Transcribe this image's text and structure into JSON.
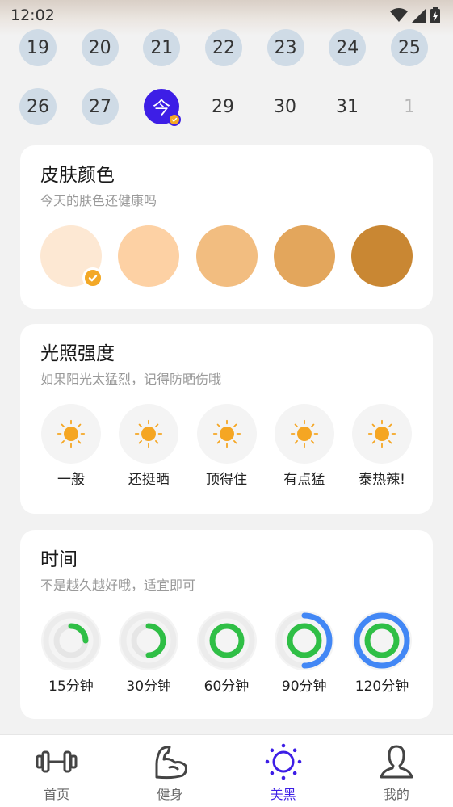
{
  "status_bar": {
    "time": "12:02",
    "icons": [
      "wifi-icon",
      "signal-icon",
      "battery-charging-icon"
    ]
  },
  "calendar": {
    "row1": [
      {
        "label": "19",
        "state": "done"
      },
      {
        "label": "20",
        "state": "done"
      },
      {
        "label": "21",
        "state": "done"
      },
      {
        "label": "22",
        "state": "done"
      },
      {
        "label": "23",
        "state": "done"
      },
      {
        "label": "24",
        "state": "done"
      },
      {
        "label": "25",
        "state": "done"
      }
    ],
    "row2": [
      {
        "label": "26",
        "state": "done"
      },
      {
        "label": "27",
        "state": "done"
      },
      {
        "label": "今",
        "state": "today"
      },
      {
        "label": "29",
        "state": "future"
      },
      {
        "label": "30",
        "state": "future"
      },
      {
        "label": "31",
        "state": "future"
      },
      {
        "label": "1",
        "state": "faded"
      }
    ]
  },
  "skin": {
    "title": "皮肤颜色",
    "subtitle": "今天的肤色还健康吗",
    "selected_index": 0,
    "colors": [
      "#fde8d3",
      "#fdd1a4",
      "#f2bd80",
      "#e3a65c",
      "#c98733"
    ]
  },
  "light": {
    "title": "光照强度",
    "subtitle": "如果阳光太猛烈，记得防晒伤哦",
    "sun_color": "#f5a623",
    "options": [
      {
        "label": "一般"
      },
      {
        "label": "还挺晒"
      },
      {
        "label": "顶得住"
      },
      {
        "label": "有点猛"
      },
      {
        "label": "泰热辣!"
      }
    ]
  },
  "duration": {
    "title": "时间",
    "subtitle": "不是越久越好哦，适宜即可",
    "green": "#2fbf46",
    "blue": "#4287f5",
    "options": [
      {
        "label": "15分钟",
        "green_fraction": 0.25,
        "blue_fraction": 0
      },
      {
        "label": "30分钟",
        "green_fraction": 0.5,
        "blue_fraction": 0
      },
      {
        "label": "60分钟",
        "green_fraction": 1,
        "blue_fraction": 0
      },
      {
        "label": "90分钟",
        "green_fraction": 1,
        "blue_fraction": 0.5
      },
      {
        "label": "120分钟",
        "green_fraction": 1,
        "blue_fraction": 1
      }
    ]
  },
  "nav": {
    "active_index": 2,
    "accent": "#3d1ee6",
    "items": [
      {
        "label": "首页",
        "icon": "dumbbell-icon"
      },
      {
        "label": "健身",
        "icon": "flexed-arm-icon"
      },
      {
        "label": "美黑",
        "icon": "sun-icon"
      },
      {
        "label": "我的",
        "icon": "person-icon"
      }
    ]
  }
}
